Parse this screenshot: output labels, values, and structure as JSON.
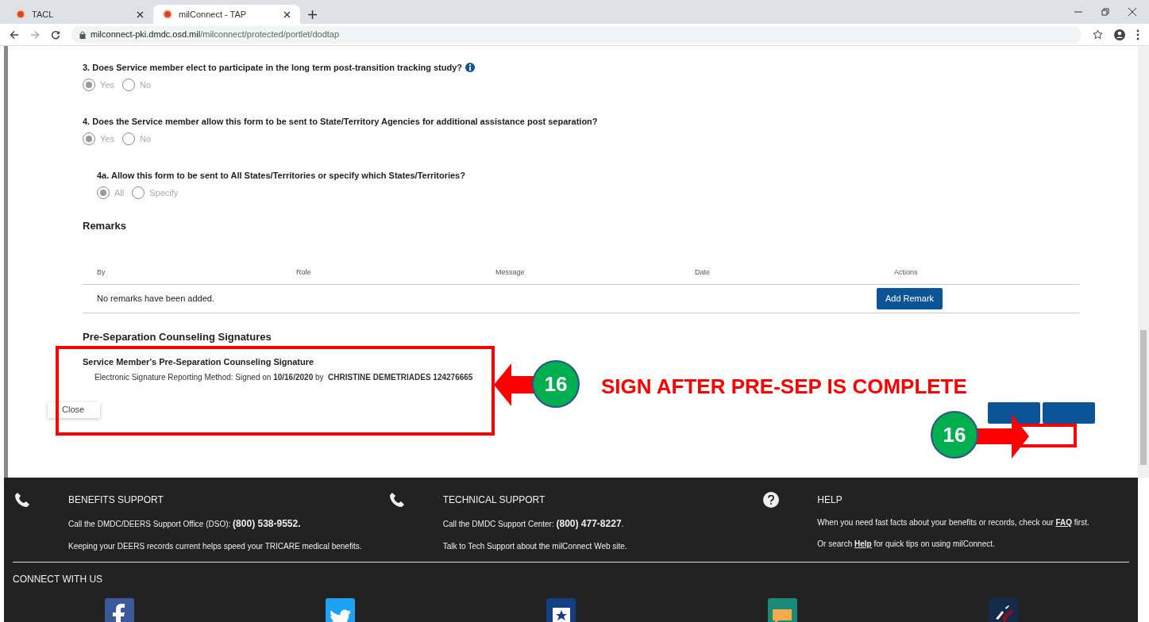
{
  "browser": {
    "tabs": [
      {
        "title": "TACL",
        "selected": false
      },
      {
        "title": "milConnect - TAP",
        "selected": true
      }
    ],
    "url_host": "milconnect-pki.dmdc.osd.mil",
    "url_path": "/milconnect/protected/portlet/dodtap"
  },
  "questions": [
    {
      "label": "3. Does Service member elect to participate in the long term post-transition tracking study?",
      "info": true,
      "options": [
        {
          "label": "Yes",
          "selected": true
        },
        {
          "label": "No",
          "selected": false
        }
      ]
    },
    {
      "label": "4. Does the Service member allow this form to be sent to State/Territory Agencies for additional assistance post separation?",
      "options": [
        {
          "label": "Yes",
          "selected": true
        },
        {
          "label": "No",
          "selected": false
        }
      ],
      "children": [
        {
          "label": "4a. Allow this form to be sent to All States/Territories or specify which States/Territories?",
          "options": [
            {
              "label": "All",
              "selected": true
            },
            {
              "label": "Specify",
              "selected": false
            }
          ]
        }
      ]
    }
  ],
  "remarks": {
    "title": "Remarks",
    "columns": [
      "By",
      "Role",
      "Message",
      "Date",
      "Actions"
    ],
    "empty_text": "No remarks have been added.",
    "add_button": "Add Remark"
  },
  "signatures": {
    "title": "Pre-Separation Counseling Signatures",
    "subtitle": "Service Member's Pre-Separation Counseling Signature",
    "line": "Electronic Signature Reporting Method: Signed on **10/16/2020** by  **CHRISTINE DEMETRIADES 124276665**"
  },
  "buttons": {
    "close": "Close"
  },
  "annotations": [
    {
      "number": "16",
      "caption": "SIGN AFTER PRE-SEP IS COMPLETE"
    },
    {
      "number": "16"
    }
  ],
  "footer": {
    "columns": [
      {
        "kind": "phone",
        "title": "BENEFITS SUPPORT",
        "lines": [
          {
            "text": "Call the DMDC/DEERS Support Office (DSO): ",
            "strong": "(800) 538-9552."
          },
          {
            "text": "Keeping your DEERS records current helps speed your TRICARE medical benefits."
          }
        ]
      },
      {
        "kind": "phone",
        "title": "TECHNICAL SUPPORT",
        "lines": [
          {
            "text": "Call the DMDC Support Center: ",
            "strong": "(800) 477-8227",
            "after": "."
          },
          {
            "text": "Talk to Tech Support about the milConnect Web site."
          }
        ]
      },
      {
        "kind": "help",
        "title": "HELP",
        "lines": [
          {
            "text": "When you need fast facts about your benefits or records, check our ",
            "link": "FAQ",
            "after": " first."
          },
          {
            "text": "Or search ",
            "link": "Help",
            "after": " for quick tips on using milConnect."
          }
        ]
      }
    ],
    "connect_title": "CONNECT WITH US",
    "social": [
      {
        "kind": "facebook"
      },
      {
        "kind": "twitter"
      },
      {
        "kind": "star"
      },
      {
        "kind": "chat"
      },
      {
        "kind": "eagle"
      }
    ]
  }
}
